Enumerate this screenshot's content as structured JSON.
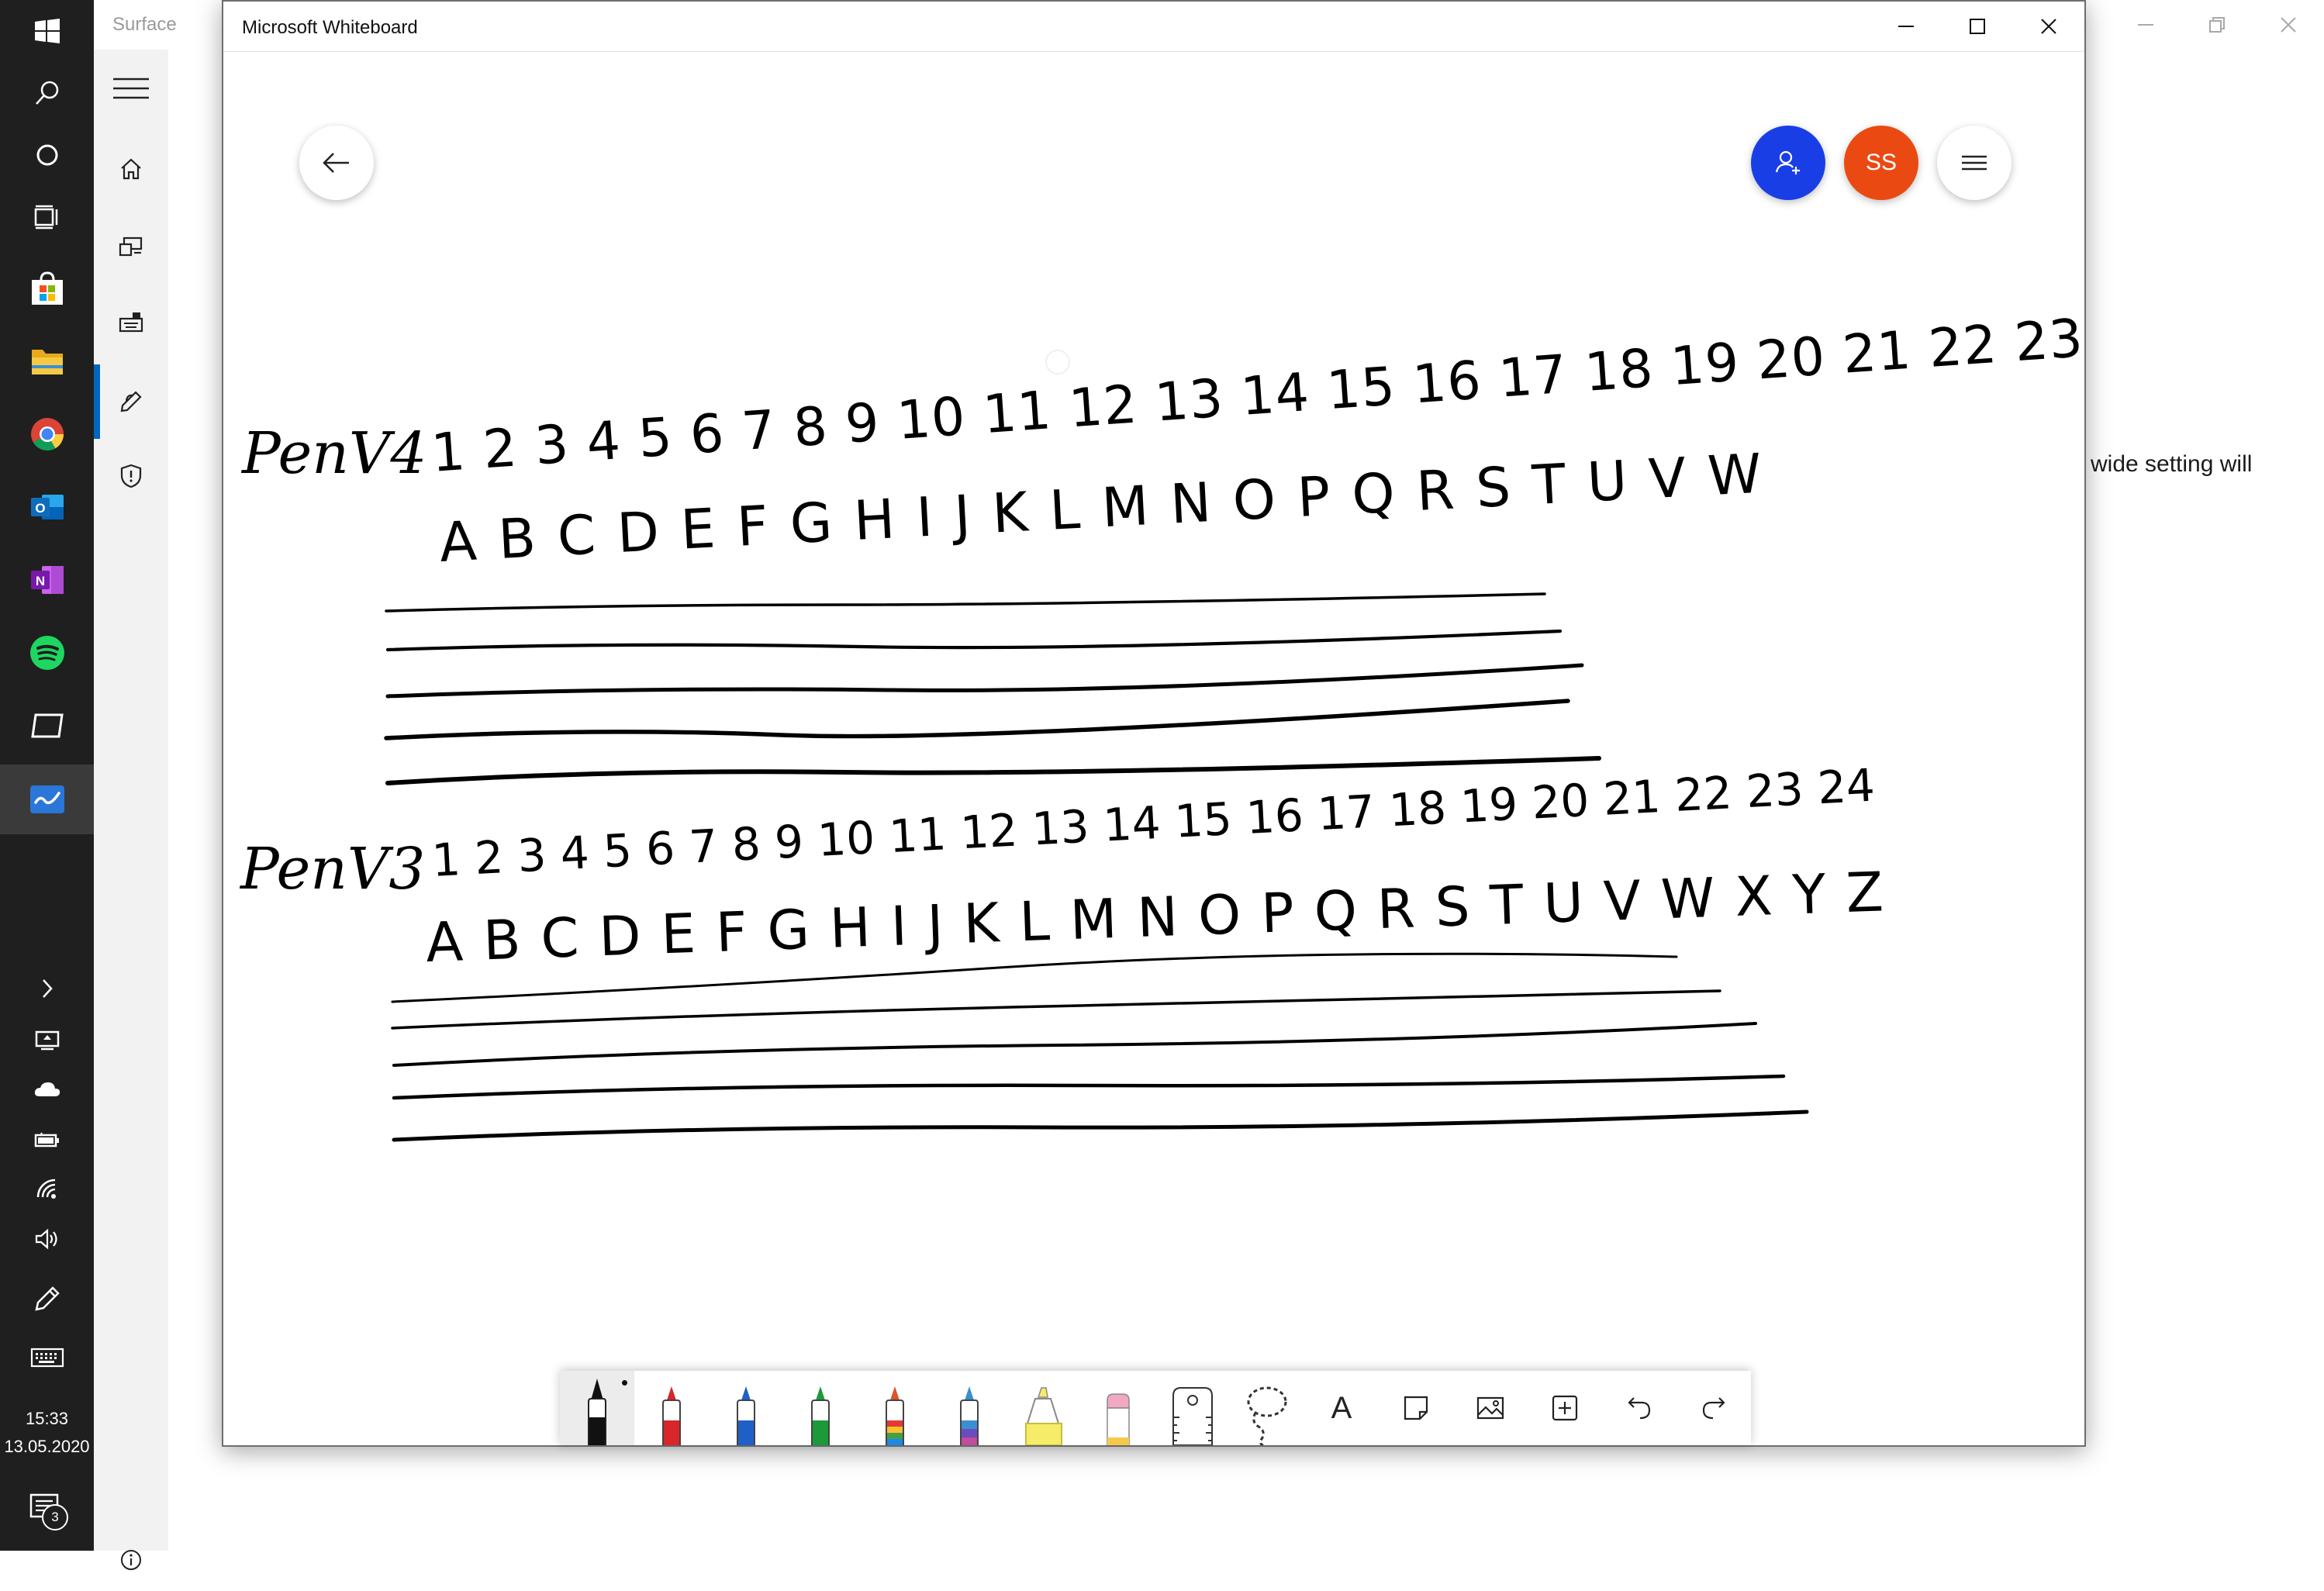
{
  "taskbar": {
    "clock_time": "15:33",
    "clock_date": "13.05.2020",
    "notification_count": "3"
  },
  "settings": {
    "title": "Surface",
    "body_text": "wide setting will"
  },
  "whiteboard": {
    "title": "Microsoft Whiteboard",
    "avatar_initials": "SS",
    "accent_colors": {
      "invite": "#1a3ee6",
      "avatar": "#ea4a12"
    },
    "ink": {
      "label_pen_v4": "PenV4",
      "v4_digits": "1 2 3 4 5 6 7 8 9 10 11 12 13 14 15 16 17 18 19 20 21 22 23",
      "v4_letters": "A B C D E F G H I J K L M N O P Q R S T U V W",
      "label_pen_v3": "PenV3",
      "v3_digits": "1 2 3 4 5 6 7 8 9 10 11 12 13 14 15 16 17 18 19 20 21 22 23 24",
      "v3_letters": "A B C D E F G H I J K L M N O P Q R S T U V W X Y Z"
    },
    "toolbar": {
      "text_tool_glyph": "A",
      "pens": [
        {
          "name": "black-pen",
          "color": "#111111"
        },
        {
          "name": "red-pen",
          "color": "#d8262a"
        },
        {
          "name": "blue-pen",
          "color": "#1f5fc8"
        },
        {
          "name": "green-pen",
          "color": "#1c9a3a"
        },
        {
          "name": "rainbow-pen",
          "color": "#e0502a"
        },
        {
          "name": "galaxy-pen",
          "color": "#6a4cc0"
        },
        {
          "name": "highlighter",
          "color": "#f6ec6a"
        },
        {
          "name": "eraser",
          "color": "#f2a7c3"
        }
      ]
    }
  }
}
